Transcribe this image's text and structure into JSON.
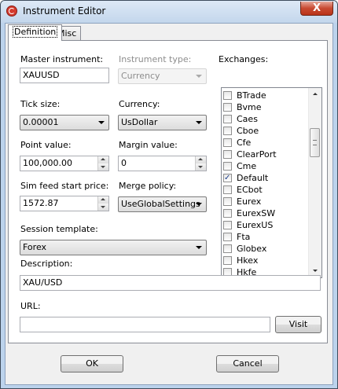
{
  "window": {
    "title": "Instrument Editor",
    "close_glyph": "X"
  },
  "tabs": [
    {
      "label": "Definition",
      "active": true
    },
    {
      "label": "Misc",
      "active": false
    }
  ],
  "fields": {
    "master_instrument": {
      "label": "Master instrument:",
      "value": "XAUUSD"
    },
    "instrument_type": {
      "label": "Instrument type:",
      "value": "Currency"
    },
    "tick_size": {
      "label": "Tick size:",
      "value": "0.00001"
    },
    "currency": {
      "label": "Currency:",
      "value": "UsDollar"
    },
    "point_value": {
      "label": "Point value:",
      "value": "100,000.00"
    },
    "margin_value": {
      "label": "Margin value:",
      "value": "0"
    },
    "sim_feed_start_price": {
      "label": "Sim feed start price:",
      "value": "1572.87"
    },
    "merge_policy": {
      "label": "Merge policy:",
      "value": "UseGlobalSettings"
    },
    "session_template": {
      "label": "Session template:",
      "value": "Forex"
    },
    "description": {
      "label": "Description:",
      "value": "XAU/USD"
    },
    "url": {
      "label": "URL:",
      "value": ""
    }
  },
  "exchanges": {
    "label": "Exchanges:",
    "items": [
      {
        "name": "BTrade",
        "checked": false
      },
      {
        "name": "Bvme",
        "checked": false
      },
      {
        "name": "Caes",
        "checked": false
      },
      {
        "name": "Cboe",
        "checked": false
      },
      {
        "name": "Cfe",
        "checked": false
      },
      {
        "name": "ClearPort",
        "checked": false
      },
      {
        "name": "Cme",
        "checked": false
      },
      {
        "name": "Default",
        "checked": true
      },
      {
        "name": "ECbot",
        "checked": false
      },
      {
        "name": "Eurex",
        "checked": false
      },
      {
        "name": "EurexSW",
        "checked": false
      },
      {
        "name": "EurexUS",
        "checked": false
      },
      {
        "name": "Fta",
        "checked": false
      },
      {
        "name": "Globex",
        "checked": false
      },
      {
        "name": "Hkex",
        "checked": false
      },
      {
        "name": "Hkfe",
        "checked": false
      }
    ]
  },
  "buttons": {
    "visit": "Visit",
    "ok": "OK",
    "cancel": "Cancel"
  },
  "colors": {
    "title_bar": "#c3d6ec",
    "close_button": "#c84a32",
    "checkmark": "#1b3d8a"
  }
}
